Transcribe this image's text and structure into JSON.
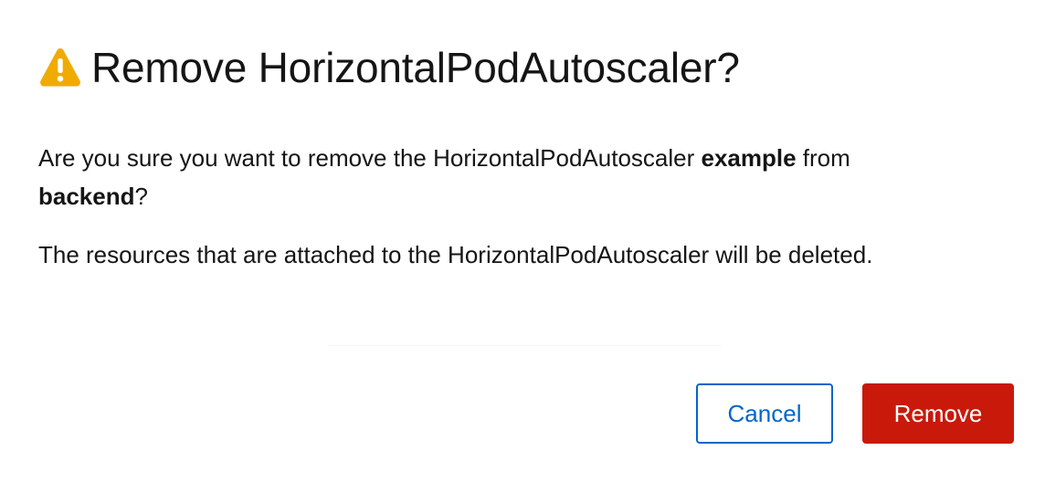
{
  "dialog": {
    "title": "Remove HorizontalPodAutoscaler?",
    "icon": "warning-triangle-icon",
    "warning_color": "#f0ab00",
    "message": {
      "part1": "Are you sure you want to remove the HorizontalPodAutoscaler ",
      "resource_name": "example",
      "part2": " from ",
      "target_name": "backend",
      "part3": "?"
    },
    "note": "The resources that are attached to the HorizontalPodAutoscaler will be deleted."
  },
  "actions": {
    "cancel_label": "Cancel",
    "remove_label": "Remove",
    "primary_color": "#0066cc",
    "danger_color": "#c9190b"
  }
}
